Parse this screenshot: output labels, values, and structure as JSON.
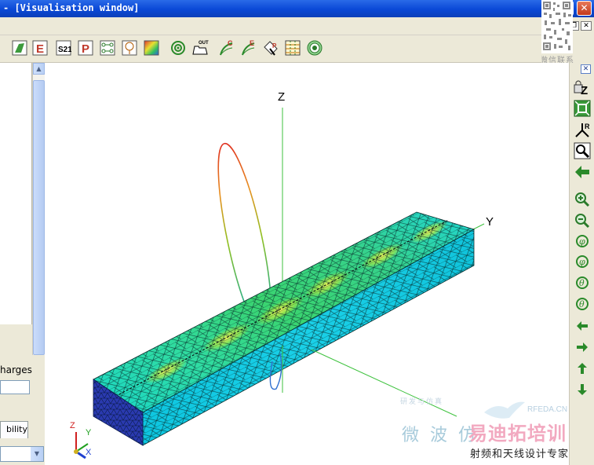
{
  "window": {
    "title": "- [Visualisation window]",
    "minimize_glyph": "_",
    "maximize_glyph": "□",
    "close_glyph": "✕"
  },
  "mdi": {
    "minimize_glyph": "_",
    "restore_glyph": "❐",
    "close_glyph": "✕"
  },
  "toolbar": {
    "items": [
      {
        "icon": "green-geometry-icon"
      },
      {
        "icon": "e-field-icon",
        "label": "E"
      },
      {
        "icon": "s21-icon",
        "label": "S21"
      },
      {
        "icon": "p-power-icon",
        "label": "P"
      },
      {
        "icon": "network-icon"
      },
      {
        "icon": "probe-icon"
      },
      {
        "icon": "colormap-icon"
      },
      {
        "icon": "target-icon"
      },
      {
        "icon": "open-out-icon",
        "label": "OUT"
      },
      {
        "icon": "c-sweep-icon",
        "label": "C"
      },
      {
        "icon": "e-sweep-icon",
        "label": "E"
      },
      {
        "icon": "p-pointer-icon",
        "label": "P"
      },
      {
        "icon": "grid-icon"
      },
      {
        "icon": "target-green-icon"
      }
    ]
  },
  "watermark_qr": {
    "caption": "微信联系"
  },
  "left_panel": {
    "charges_text": "harges",
    "tab_label": "bility"
  },
  "viewport": {
    "axis_z": "Z",
    "axis_y": "Y",
    "triad_z": "Z",
    "triad_y": "Y",
    "triad_x": "X",
    "watermark_cn": "微波仿",
    "watermark_small": "研发与仿真",
    "watermark_site": "RFEDA.CN",
    "watermark_brand": "易迪拓培训",
    "watermark_subtitle": "射频和天线设计专家"
  },
  "right_toolbar": {
    "close_glyph": "✕",
    "items": [
      {
        "icon": "lock-z-icon"
      },
      {
        "icon": "fit-view-icon"
      },
      {
        "icon": "axes-r-icon"
      },
      {
        "icon": "zoom-box-icon"
      },
      {
        "icon": "back-arrow-icon"
      },
      {
        "icon": "zoom-in-icon"
      },
      {
        "icon": "zoom-out-icon"
      },
      {
        "icon": "rotate-phi-plus-icon"
      },
      {
        "icon": "rotate-phi-minus-icon"
      },
      {
        "icon": "rotate-theta-plus-icon"
      },
      {
        "icon": "rotate-theta-minus-icon"
      },
      {
        "icon": "pan-left-icon"
      },
      {
        "icon": "pan-right-icon"
      },
      {
        "icon": "pan-up-icon"
      },
      {
        "icon": "pan-down-icon"
      }
    ]
  }
}
